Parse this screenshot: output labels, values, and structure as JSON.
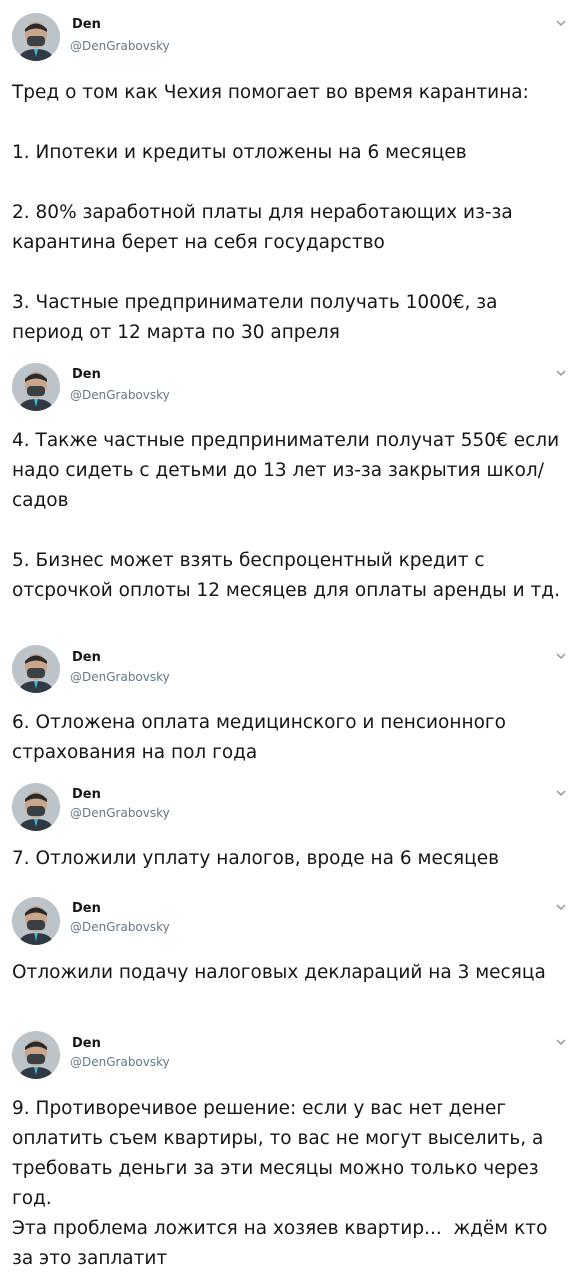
{
  "author": {
    "name": "Den",
    "handle": "@DenGrabovsky"
  },
  "icons": {
    "avatar": "avatar-photo",
    "menu": "chevron-down-icon"
  },
  "tweets": [
    {
      "text": "Тред о том как Чехия помогает во время карантина:\n\n1. Ипотеки и кредиты отложены на 6 месяцев\n\n2. 80% заработной платы для неработающих из-за карантина берет на себя государство\n\n3. Частные предприниматели получать 1000€, за период от 12 марта по 30 апреля"
    },
    {
      "text": "4. Также частные предприниматели получат 550€ если надо сидеть с детьми до 13 лет из-за закрытия школ/садов\n\n5. Бизнес может взять беспроцентный кредит с отсрочкой оплоты 12 месяцев для оплаты аренды и тд."
    },
    {
      "text": "6. Отложена оплата медицинского и пенсионного страхования на пол года"
    },
    {
      "text": "7. Отложили уплату налогов, вроде на 6 месяцев"
    },
    {
      "text": "Отложили подачу налоговых деклараций на 3 месяца"
    },
    {
      "text": "9. Противоречивое решение: если у вас нет денег оплатить съем квартиры, то вас не могут выселить, а требовать деньги за эти месяцы можно только через год.\nЭта проблема ложится на хозяев квартир...  ждём кто за это заплатит"
    }
  ]
}
